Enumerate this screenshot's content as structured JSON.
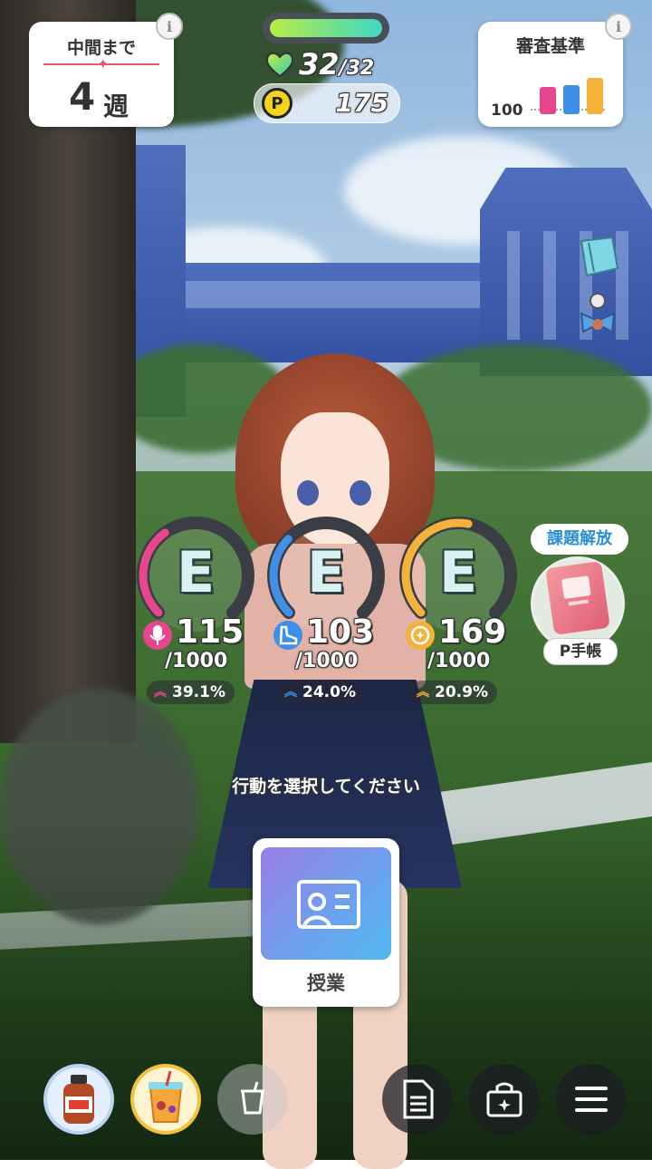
{
  "hud": {
    "weeks": {
      "title": "中間まで",
      "number": "4",
      "unit": "週"
    },
    "criteria": {
      "title": "審査基準",
      "value": "100",
      "bar_colors": [
        "#e8458f",
        "#3f8fe8",
        "#f5b23a"
      ]
    },
    "hp": {
      "current": "32",
      "max": "32",
      "fill_fraction": 1.0
    },
    "p_points": {
      "coin": "P",
      "value": "175"
    }
  },
  "stats": [
    {
      "grade": "E",
      "value": "115",
      "max": "/1000",
      "bonus": "39.1%",
      "color": "#e8458f",
      "fill_fraction": 0.115,
      "icon": "microphone-icon"
    },
    {
      "grade": "E",
      "value": "103",
      "max": "/1000",
      "bonus": "24.0%",
      "color": "#3f8fe8",
      "fill_fraction": 0.103,
      "icon": "shoe-icon"
    },
    {
      "grade": "E",
      "value": "169",
      "max": "/1000",
      "bonus": "20.9%",
      "color": "#f5b23a",
      "fill_fraction": 0.169,
      "icon": "gear-sparkle-icon"
    }
  ],
  "notebook": {
    "task_label": "課題解放",
    "label": "P手帳"
  },
  "prompt": "行動を選択してください",
  "action": {
    "label": "授業"
  },
  "bottom": {
    "items": [
      "tea-bottle-icon",
      "juice-cup-icon",
      "empty-cup-icon"
    ],
    "buttons": [
      "document-icon",
      "present-box-icon",
      "menu-icon"
    ]
  }
}
